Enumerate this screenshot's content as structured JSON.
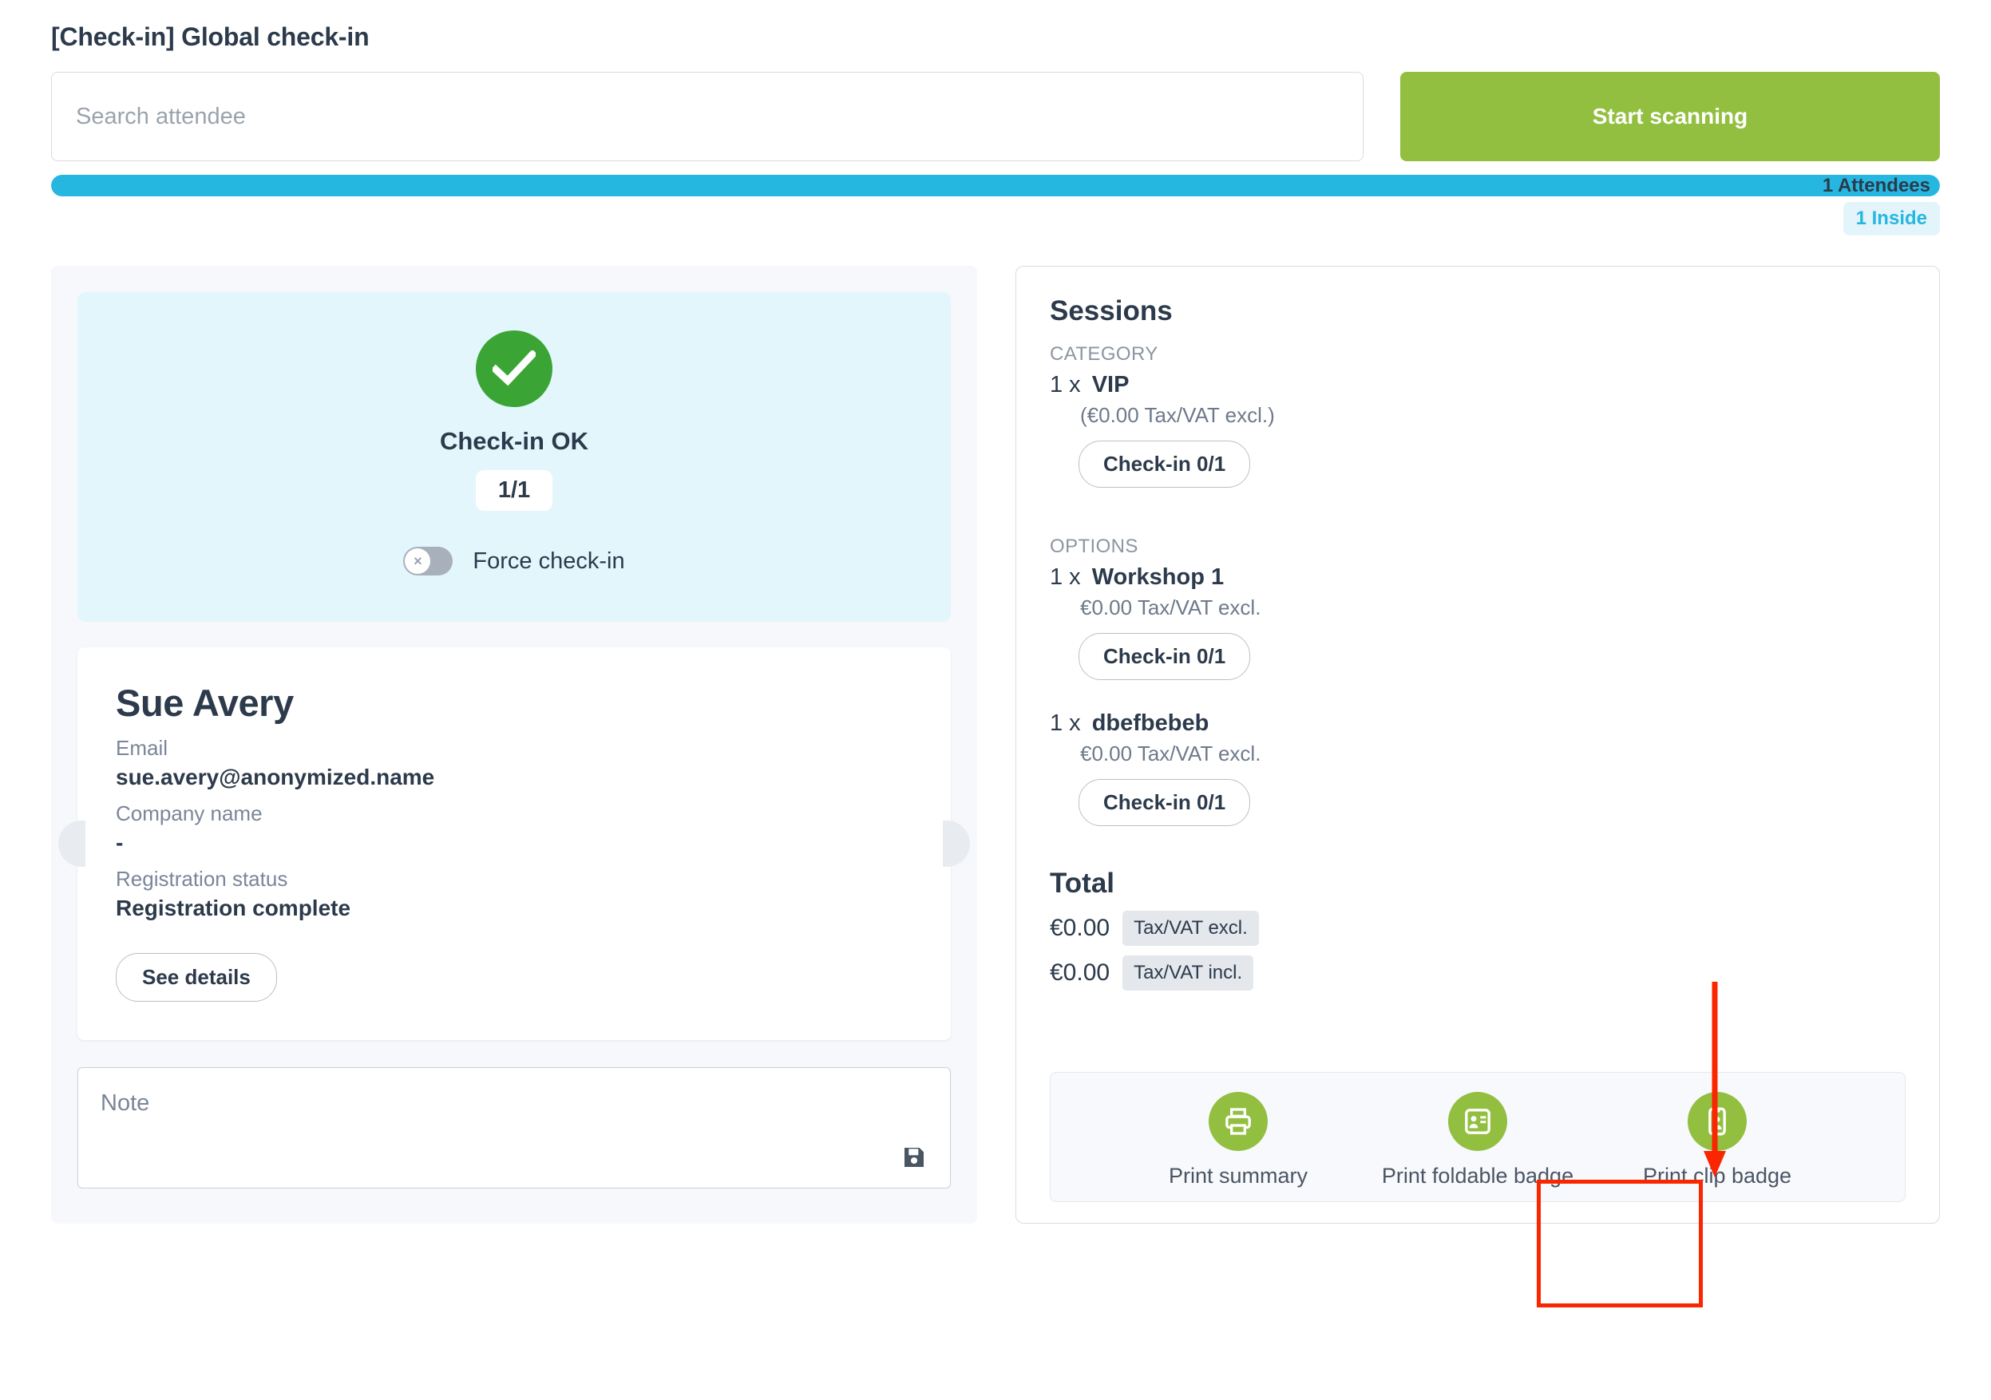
{
  "header": {
    "title": "[Check-in] Global check-in",
    "search_placeholder": "Search attendee",
    "search_value": "",
    "scan_button": "Start scanning"
  },
  "progress": {
    "attendees_label": "1 Attendees",
    "inside_label": "1 Inside",
    "fill_percent": 100,
    "bar_color": "#25b7e0",
    "inside_color": "#25b7e0"
  },
  "checkin": {
    "status": "Check-in OK",
    "count": "1/1",
    "force_label": "Force check-in",
    "force_enabled": false,
    "circle_color": "#3aa534",
    "panel_color": "#e3f6fc"
  },
  "attendee": {
    "name": "Sue Avery",
    "email_label": "Email",
    "email_value": "sue.avery@anonymized.name",
    "company_label": "Company name",
    "company_value": "-",
    "status_label": "Registration status",
    "status_value": "Registration complete",
    "see_details": "See details"
  },
  "note": {
    "placeholder": "Note",
    "value": ""
  },
  "sessions": {
    "title": "Sessions",
    "groups": [
      {
        "label": "CATEGORY",
        "items": [
          {
            "qty": "1 x",
            "name": "VIP",
            "price": "(€0.00 Tax/VAT excl.)",
            "checkin": "Check-in 0/1"
          }
        ]
      },
      {
        "label": "OPTIONS",
        "items": [
          {
            "qty": "1 x",
            "name": "Workshop 1",
            "price": "€0.00 Tax/VAT excl.",
            "checkin": "Check-in 0/1"
          },
          {
            "qty": "1 x",
            "name": "dbefbebeb",
            "price": "€0.00 Tax/VAT excl.",
            "checkin": "Check-in 0/1"
          }
        ]
      }
    ]
  },
  "total": {
    "title": "Total",
    "rows": [
      {
        "amount": "€0.00",
        "tag": "Tax/VAT excl."
      },
      {
        "amount": "€0.00",
        "tag": "Tax/VAT incl."
      }
    ]
  },
  "print": {
    "items": [
      {
        "label": "Print summary",
        "icon": "printer-icon"
      },
      {
        "label": "Print foldable badge",
        "icon": "foldable-badge-icon"
      },
      {
        "label": "Print clip badge",
        "icon": "clip-badge-icon"
      }
    ],
    "icon_color": "#92bf40"
  },
  "annotation": {
    "color": "#fa2600",
    "target": "Print clip badge"
  }
}
